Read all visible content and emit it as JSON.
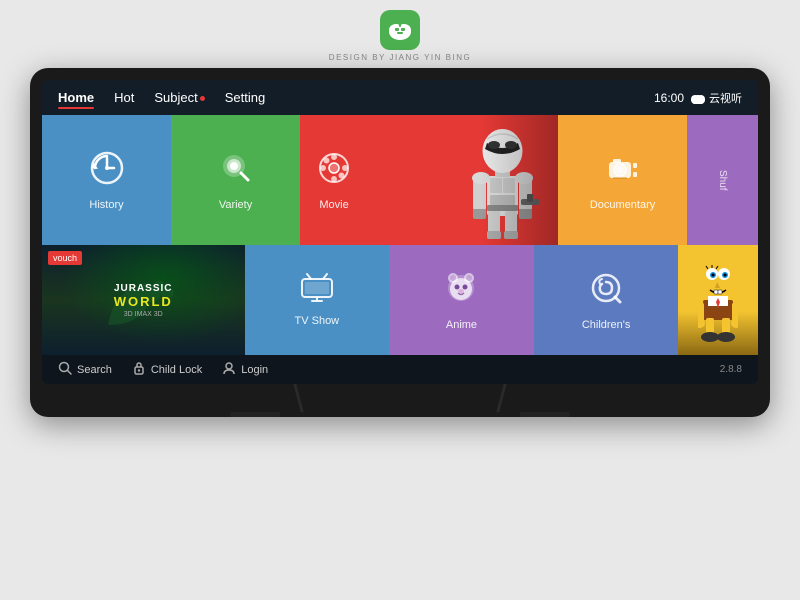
{
  "logo": {
    "text": "DESIGN BY JIANG YIN BING"
  },
  "nav": {
    "items": [
      {
        "label": "Home",
        "active": true,
        "dot": false
      },
      {
        "label": "Hot",
        "active": false,
        "dot": false
      },
      {
        "label": "Subject",
        "active": false,
        "dot": true
      },
      {
        "label": "Setting",
        "active": false,
        "dot": false
      }
    ],
    "time": "16:00",
    "brand": "云视听"
  },
  "tiles_row1": [
    {
      "id": "history",
      "label": "History",
      "color": "#4a90c4"
    },
    {
      "id": "variety",
      "label": "Variety",
      "color": "#4caf50"
    },
    {
      "id": "movie",
      "label": "Movie",
      "color": "#e53935"
    },
    {
      "id": "documentary",
      "label": "Documentary",
      "color": "#f4a636"
    },
    {
      "id": "shuffle",
      "label": "Shuf",
      "color": "#9c6abf"
    }
  ],
  "tiles_row2": [
    {
      "id": "jurassic",
      "label": "JURASSIC WORLD",
      "sub": "3D IMAX 3D",
      "badge": "vouch",
      "color": "#1a3a5c"
    },
    {
      "id": "tvshow",
      "label": "TV Show",
      "color": "#4a90c4"
    },
    {
      "id": "anime",
      "label": "Anime",
      "color": "#9c6abf"
    },
    {
      "id": "childrens",
      "label": "Children's",
      "color": "#5b7abf"
    }
  ],
  "bottom_bar": {
    "items": [
      {
        "label": "Search",
        "icon": "search"
      },
      {
        "label": "Child Lock",
        "icon": "lock"
      },
      {
        "label": "Login",
        "icon": "user"
      }
    ],
    "version": "2.8.8"
  }
}
